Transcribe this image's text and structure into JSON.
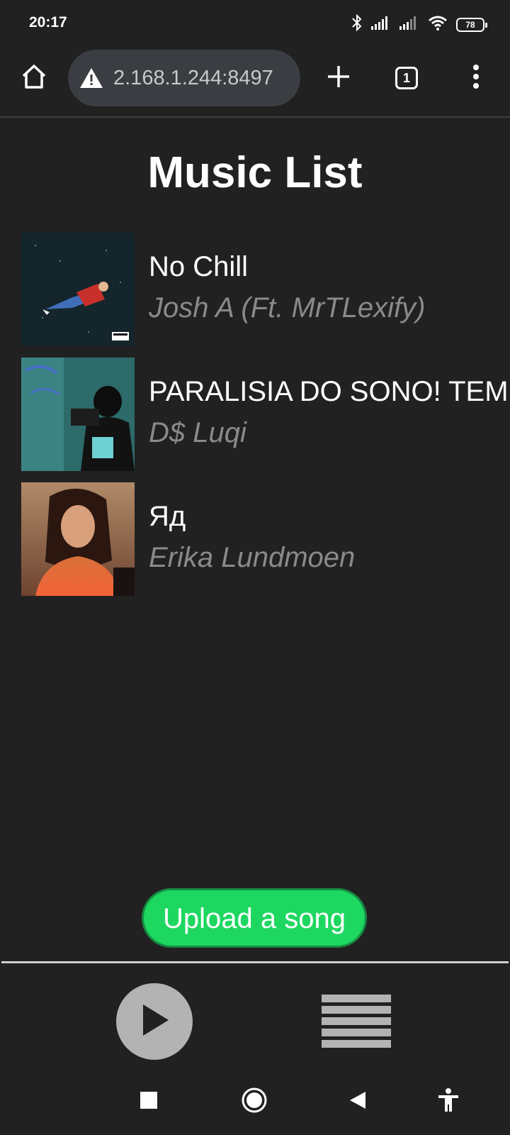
{
  "status_bar": {
    "time": "20:17",
    "battery": "78",
    "icons": [
      "bluetooth-icon",
      "signal-icon",
      "signal-icon",
      "wifi-icon",
      "battery-icon"
    ]
  },
  "browser": {
    "url": "2.168.1.244:8497",
    "tab_count": "1",
    "icons": [
      "home-icon",
      "warning-icon",
      "plus-icon",
      "tab-switcher-icon",
      "more-vert-icon"
    ]
  },
  "page": {
    "title": "Music List",
    "songs": [
      {
        "title": "No Chill",
        "artist": "Josh A (Ft. MrTLexify)"
      },
      {
        "title": "PARALISIA DO SONO! TEM",
        "artist": "D$ Luqi"
      },
      {
        "title": "Яд",
        "artist": "Erika Lundmoen"
      }
    ],
    "upload_label": "Upload a song"
  },
  "player": {
    "icons": [
      "play-icon",
      "playlist-icon"
    ]
  },
  "colors": {
    "background": "#212121",
    "accent": "#1ed760",
    "muted_text": "#8a8a8a"
  }
}
